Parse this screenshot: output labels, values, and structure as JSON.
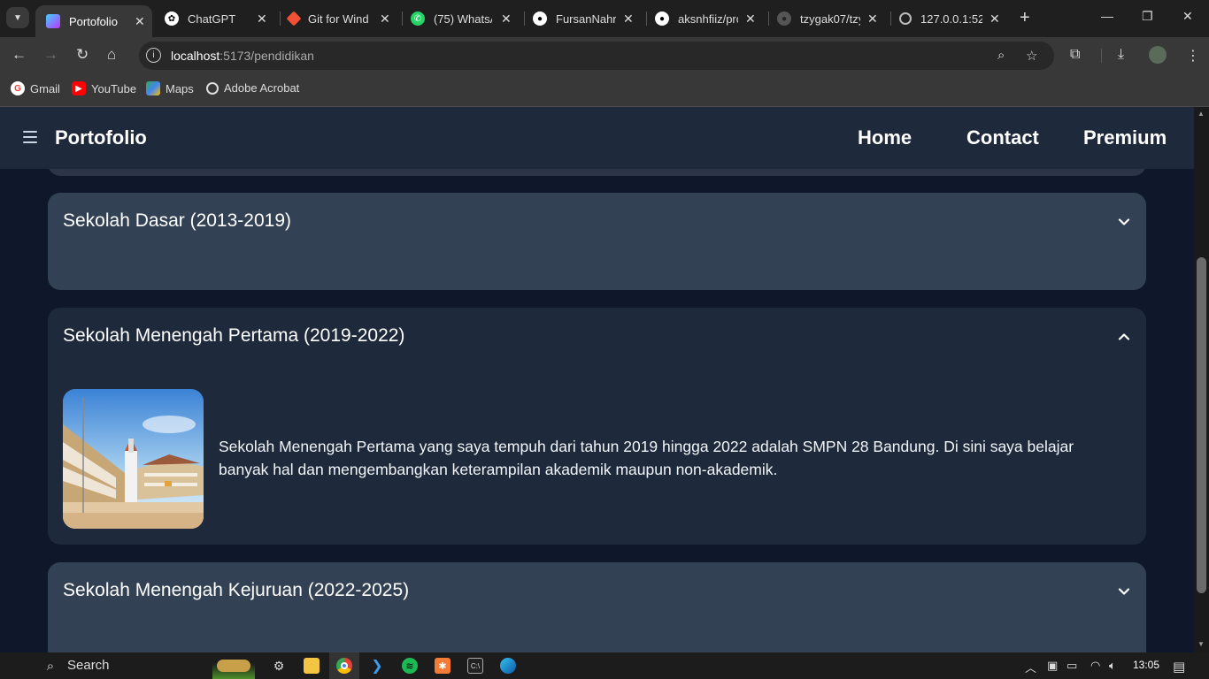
{
  "browser": {
    "tabs": [
      {
        "title": "Portofolio",
        "icon": "vite-icon",
        "active": true
      },
      {
        "title": "ChatGPT",
        "icon": "chatgpt-icon"
      },
      {
        "title": "Git for Wind",
        "icon": "git-icon"
      },
      {
        "title": "(75) WhatsAp",
        "icon": "whatsapp-icon"
      },
      {
        "title": "FursanNahr/",
        "icon": "github-icon"
      },
      {
        "title": "aksnhfiiz/prc",
        "icon": "github-icon"
      },
      {
        "title": "tzygak07/tzy",
        "icon": "github-icon"
      },
      {
        "title": "127.0.0.1:52",
        "icon": "globe-icon"
      }
    ],
    "url_host": "localhost",
    "url_path": ":5173/pendidikan",
    "bookmarks": [
      {
        "label": "Gmail",
        "icon": "google-icon"
      },
      {
        "label": "YouTube",
        "icon": "youtube-icon"
      },
      {
        "label": "Maps",
        "icon": "maps-icon"
      },
      {
        "label": "Adobe Acrobat",
        "icon": "globe-icon"
      }
    ]
  },
  "page": {
    "brand": "Portofolio",
    "nav": {
      "home": "Home",
      "contact": "Contact",
      "premium": "Premium"
    },
    "education": [
      {
        "title": "Sekolah Dasar (2013-2019)",
        "expanded": false
      },
      {
        "title": "Sekolah Menengah Pertama (2019-2022)",
        "expanded": true,
        "description": "Sekolah Menengah Pertama yang saya tempuh dari tahun 2019 hingga 2022 adalah SMPN 28 Bandung. Di sini saya belajar banyak hal dan mengembangkan keterampilan akademik maupun non-akademik."
      },
      {
        "title": "Sekolah Menengah Kejuruan (2022-2025)",
        "expanded": false
      }
    ]
  },
  "taskbar": {
    "search_label": "Search",
    "time": "13:05"
  },
  "colors": {
    "page_bg": "#0f172a",
    "navbar_bg": "#1e293b",
    "card_collapsed": "#334155",
    "card_expanded": "#1e293b"
  }
}
